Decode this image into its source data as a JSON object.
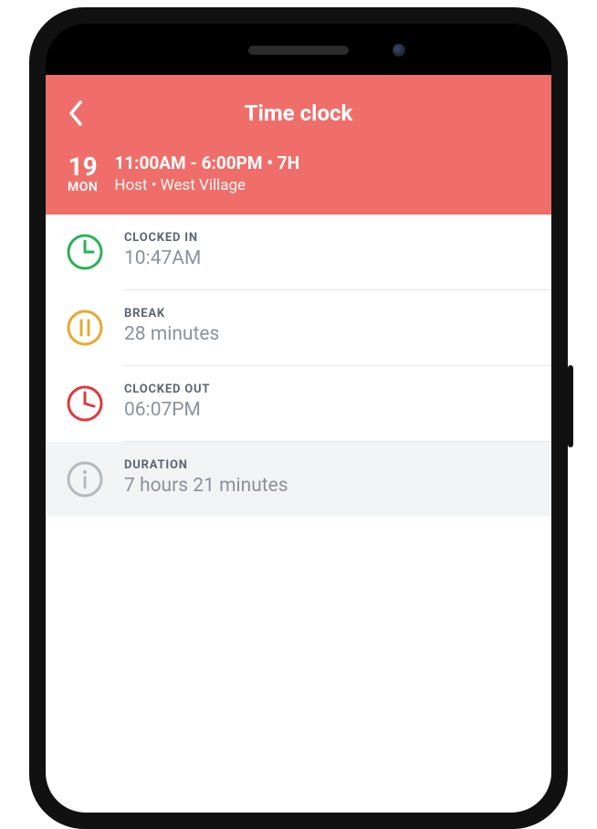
{
  "header": {
    "title": "Time clock",
    "date_num": "19",
    "date_day": "MON",
    "shift_time": "11:00AM - 6:00PM • 7H",
    "shift_meta": "Host • West Village"
  },
  "rows": {
    "clocked_in": {
      "label": "CLOCKED IN",
      "value": "10:47AM"
    },
    "break": {
      "label": "BREAK",
      "value": "28 minutes"
    },
    "clocked_out": {
      "label": "CLOCKED OUT",
      "value": "06:07PM"
    },
    "duration": {
      "label": "DURATION",
      "value": "7 hours 21 minutes"
    }
  },
  "colors": {
    "accent": "#ef6e6a",
    "green": "#2bb158",
    "amber": "#e8a82f",
    "red": "#e0383f",
    "gray": "#b3b9c0"
  }
}
